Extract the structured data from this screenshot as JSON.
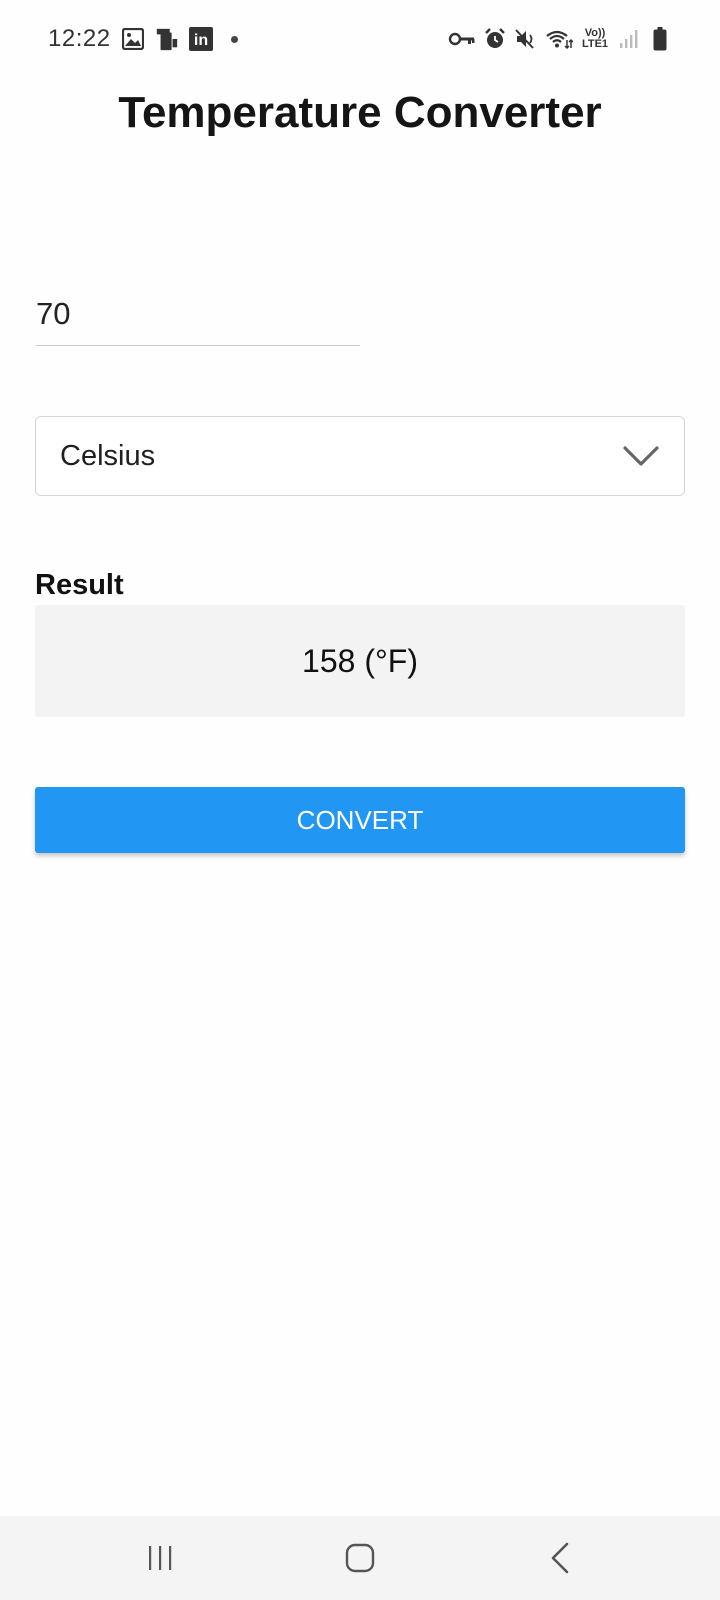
{
  "status_bar": {
    "time": "12:22",
    "left_icons": [
      "gallery-icon",
      "device-icon",
      "linkedin-icon"
    ],
    "right_icons": [
      "vpn-key-icon",
      "alarm-icon",
      "mute-icon",
      "wifi-icon",
      "lte-icon",
      "signal-icon",
      "battery-icon"
    ],
    "lte_top": "Vo))",
    "lte_bottom": "LTE1",
    "linkedin_text": "in"
  },
  "app": {
    "title": "Temperature Converter"
  },
  "input": {
    "value": "70",
    "placeholder": ""
  },
  "unit_select": {
    "selected": "Celsius"
  },
  "result": {
    "label": "Result",
    "value": "158 (°F)"
  },
  "convert_button": {
    "label": "CONVERT"
  },
  "colors": {
    "accent": "#2196f3",
    "result_bg": "#f3f3f3",
    "nav_bg": "#f4f4f4"
  },
  "nav_bar": {
    "items": [
      "recents-icon",
      "home-icon",
      "back-icon"
    ]
  }
}
